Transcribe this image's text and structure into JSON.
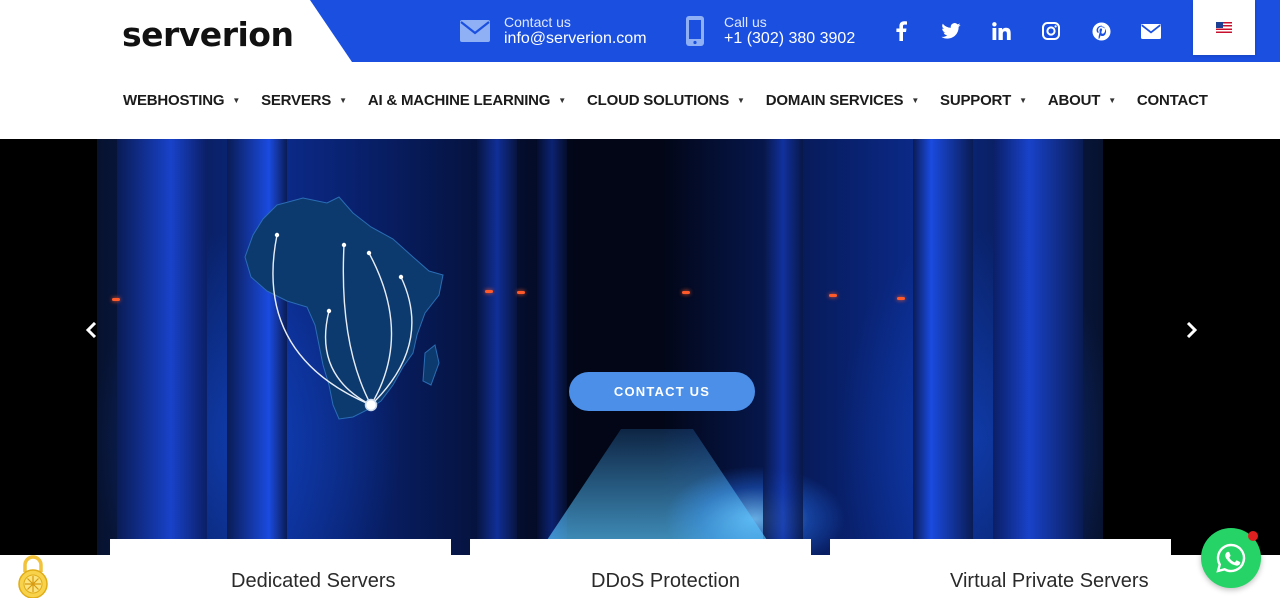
{
  "brand": {
    "logo_text": "serverion",
    "accent_color": "#1a4fe0"
  },
  "topbar": {
    "email": {
      "label": "Contact us",
      "value": "info@serverion.com",
      "icon": "envelope-icon"
    },
    "phone": {
      "label": "Call us",
      "value": "+1 (302) 380 3902",
      "icon": "mobile-phone-icon"
    },
    "socials": [
      "facebook-icon",
      "twitter-icon",
      "linkedin-icon",
      "instagram-icon",
      "pinterest-icon",
      "email-icon"
    ],
    "language": {
      "flag": "us-flag-icon"
    }
  },
  "nav": {
    "items": [
      {
        "label": "WEBHOSTING",
        "dropdown": true
      },
      {
        "label": "SERVERS",
        "dropdown": true
      },
      {
        "label": "AI & MACHINE LEARNING",
        "dropdown": true
      },
      {
        "label": "CLOUD SOLUTIONS",
        "dropdown": true
      },
      {
        "label": "DOMAIN SERVICES",
        "dropdown": true
      },
      {
        "label": "SUPPORT",
        "dropdown": true
      },
      {
        "label": "ABOUT",
        "dropdown": true
      },
      {
        "label": "CONTACT",
        "dropdown": false
      }
    ]
  },
  "hero": {
    "cta_label": "CONTACT US",
    "prev_icon": "chevron-left-icon",
    "next_icon": "chevron-right-icon"
  },
  "features": [
    {
      "label": "Dedicated Servers"
    },
    {
      "label": "DDoS Protection"
    },
    {
      "label": "Virtual Private Servers"
    }
  ],
  "widgets": {
    "cookie_icon": "cookie-lock-icon",
    "whatsapp_icon": "whatsapp-icon",
    "whatsapp_color": "#25d366"
  }
}
